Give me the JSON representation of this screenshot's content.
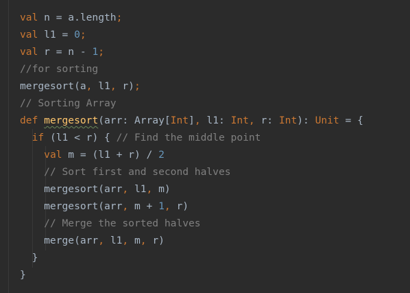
{
  "editor": {
    "lines": [
      {
        "tokens": [
          {
            "c": "kw",
            "t": "val"
          },
          {
            "c": "txt",
            "t": " n = a.length"
          },
          {
            "c": "punc",
            "t": ";"
          }
        ]
      },
      {
        "tokens": [
          {
            "c": "kw",
            "t": "val"
          },
          {
            "c": "txt",
            "t": " l1 = "
          },
          {
            "c": "num",
            "t": "0"
          },
          {
            "c": "punc",
            "t": ";"
          }
        ]
      },
      {
        "tokens": [
          {
            "c": "kw",
            "t": "val"
          },
          {
            "c": "txt",
            "t": " r = n - "
          },
          {
            "c": "num",
            "t": "1"
          },
          {
            "c": "punc",
            "t": ";"
          }
        ]
      },
      {
        "tokens": [
          {
            "c": "cmt",
            "t": "//for sorting"
          }
        ]
      },
      {
        "tokens": [
          {
            "c": "txt",
            "t": "mergesort(a"
          },
          {
            "c": "punc",
            "t": ","
          },
          {
            "c": "txt",
            "t": " l1"
          },
          {
            "c": "punc",
            "t": ","
          },
          {
            "c": "txt",
            "t": " r)"
          },
          {
            "c": "punc",
            "t": ";"
          }
        ]
      },
      {
        "tokens": [
          {
            "c": "cmt",
            "t": "// Sorting Array"
          }
        ]
      },
      {
        "tokens": [
          {
            "c": "kw",
            "t": "def"
          },
          {
            "c": "txt",
            "t": " "
          },
          {
            "c": "fn-decl",
            "t": "mergesort"
          },
          {
            "c": "txt",
            "t": "(arr: Array["
          },
          {
            "c": "typeparam",
            "t": "Int"
          },
          {
            "c": "txt",
            "t": "]"
          },
          {
            "c": "punc",
            "t": ","
          },
          {
            "c": "txt",
            "t": " l1: "
          },
          {
            "c": "typeparam",
            "t": "Int"
          },
          {
            "c": "punc",
            "t": ","
          },
          {
            "c": "txt",
            "t": " r: "
          },
          {
            "c": "typeparam",
            "t": "Int"
          },
          {
            "c": "txt",
            "t": "): "
          },
          {
            "c": "typeparam",
            "t": "Unit"
          },
          {
            "c": "txt",
            "t": " = {"
          }
        ]
      },
      {
        "tokens": [
          {
            "c": "txt",
            "t": "  "
          },
          {
            "c": "kw",
            "t": "if"
          },
          {
            "c": "txt",
            "t": " (l1 < r) { "
          },
          {
            "c": "cmt",
            "t": "// Find the middle point"
          }
        ]
      },
      {
        "tokens": [
          {
            "c": "txt",
            "t": "    "
          },
          {
            "c": "kw",
            "t": "val"
          },
          {
            "c": "txt",
            "t": " m = (l1 + r) / "
          },
          {
            "c": "num",
            "t": "2"
          }
        ]
      },
      {
        "tokens": [
          {
            "c": "txt",
            "t": "    "
          },
          {
            "c": "cmt",
            "t": "// Sort first and second halves"
          }
        ]
      },
      {
        "tokens": [
          {
            "c": "txt",
            "t": "    mergesort(arr"
          },
          {
            "c": "punc",
            "t": ","
          },
          {
            "c": "txt",
            "t": " l1"
          },
          {
            "c": "punc",
            "t": ","
          },
          {
            "c": "txt",
            "t": " m)"
          }
        ]
      },
      {
        "tokens": [
          {
            "c": "txt",
            "t": "    mergesort(arr"
          },
          {
            "c": "punc",
            "t": ","
          },
          {
            "c": "txt",
            "t": " m + "
          },
          {
            "c": "num",
            "t": "1"
          },
          {
            "c": "punc",
            "t": ","
          },
          {
            "c": "txt",
            "t": " r)"
          }
        ]
      },
      {
        "tokens": [
          {
            "c": "txt",
            "t": "    "
          },
          {
            "c": "cmt",
            "t": "// Merge the sorted halves"
          }
        ]
      },
      {
        "tokens": [
          {
            "c": "txt",
            "t": "    merge(arr"
          },
          {
            "c": "punc",
            "t": ","
          },
          {
            "c": "txt",
            "t": " l1"
          },
          {
            "c": "punc",
            "t": ","
          },
          {
            "c": "txt",
            "t": " m"
          },
          {
            "c": "punc",
            "t": ","
          },
          {
            "c": "txt",
            "t": " r)"
          }
        ]
      },
      {
        "tokens": [
          {
            "c": "txt",
            "t": "  }"
          }
        ]
      },
      {
        "tokens": [
          {
            "c": "txt",
            "t": "}"
          }
        ]
      }
    ]
  },
  "colors": {
    "background": "#2b2b2b",
    "keyword": "#cc7832",
    "number": "#6897bb",
    "comment": "#808080",
    "text": "#a9b7c6",
    "function_declaration": "#ffc66d"
  }
}
